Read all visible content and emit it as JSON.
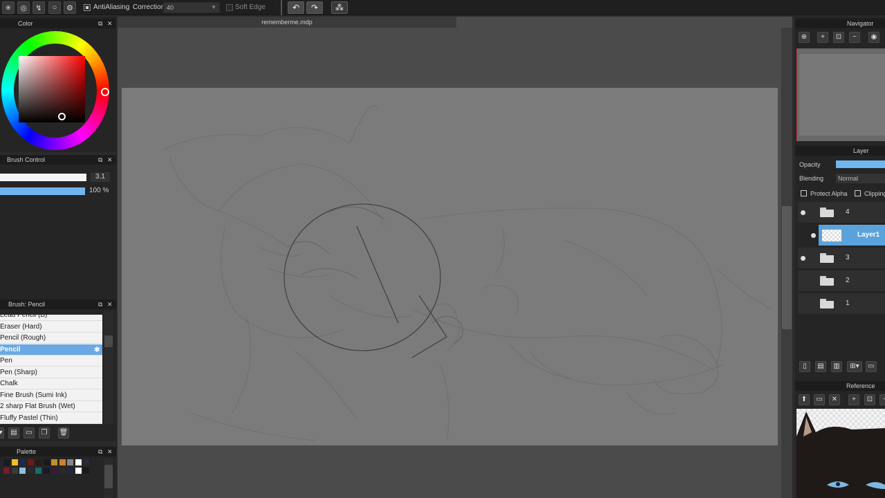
{
  "toolbar": {
    "antialiasing_label": "AntiAliasing",
    "correction_label": "Correction",
    "correction_value": "40",
    "soft_edge_label": "Soft Edge"
  },
  "document": {
    "tab_title": "rememberme.mdp"
  },
  "color_panel": {
    "title": "Color",
    "accent_color": "#ff0000"
  },
  "brush_control": {
    "title": "Brush Control",
    "size_value": "3.1",
    "opacity_value": "100 %",
    "opacity_fraction": 1.0
  },
  "brush_panel": {
    "title": "Brush: Pencil",
    "items": [
      "Lead Pencil (B)",
      "Eraser (Hard)",
      "Pencil (Rough)",
      "Pencil",
      "Pen",
      "Pen (Sharp)",
      "Chalk",
      "Fine Brush (Sumi Ink)",
      "2 sharp Flat Brush (Wet)",
      "Fluffy Pastel (Thin)"
    ],
    "selected_index": 3
  },
  "palette_panel": {
    "title": "Palette",
    "swatches_row1": [
      "#1a1a22",
      "#f0c020",
      "#1d2a4a",
      "#6a1a1a",
      "#2a1a1a",
      "#1a1a1a",
      "#c0902a",
      "#d08030",
      "#888888",
      "#ffffff",
      "#2a2a3a"
    ],
    "swatches_row2": [
      "#7a1a2a",
      "#3a3a3a",
      "#8ac0e0",
      "#2a2a2a",
      "#1a6a6a",
      "#1a1a2a",
      "#3a1a3a",
      "#2a2a2a",
      "#1a2a3a",
      "#ffffff",
      "#1a1a1a"
    ]
  },
  "navigator": {
    "title": "Navigator"
  },
  "layer_panel": {
    "title": "Layer",
    "opacity_label": "Opacity",
    "blending_label": "Blending",
    "blending_value": "Normal",
    "protect_alpha_label": "Protect Alpha",
    "clipping_label": "Clipping",
    "layers": [
      {
        "name": "4",
        "type": "folder",
        "visible": true
      },
      {
        "name": "Layer1",
        "type": "layer",
        "visible": true
      },
      {
        "name": "3",
        "type": "folder",
        "visible": true
      },
      {
        "name": "2",
        "type": "folder",
        "visible": false
      },
      {
        "name": "1",
        "type": "folder",
        "visible": false
      }
    ]
  },
  "reference_panel": {
    "title": "Reference"
  }
}
